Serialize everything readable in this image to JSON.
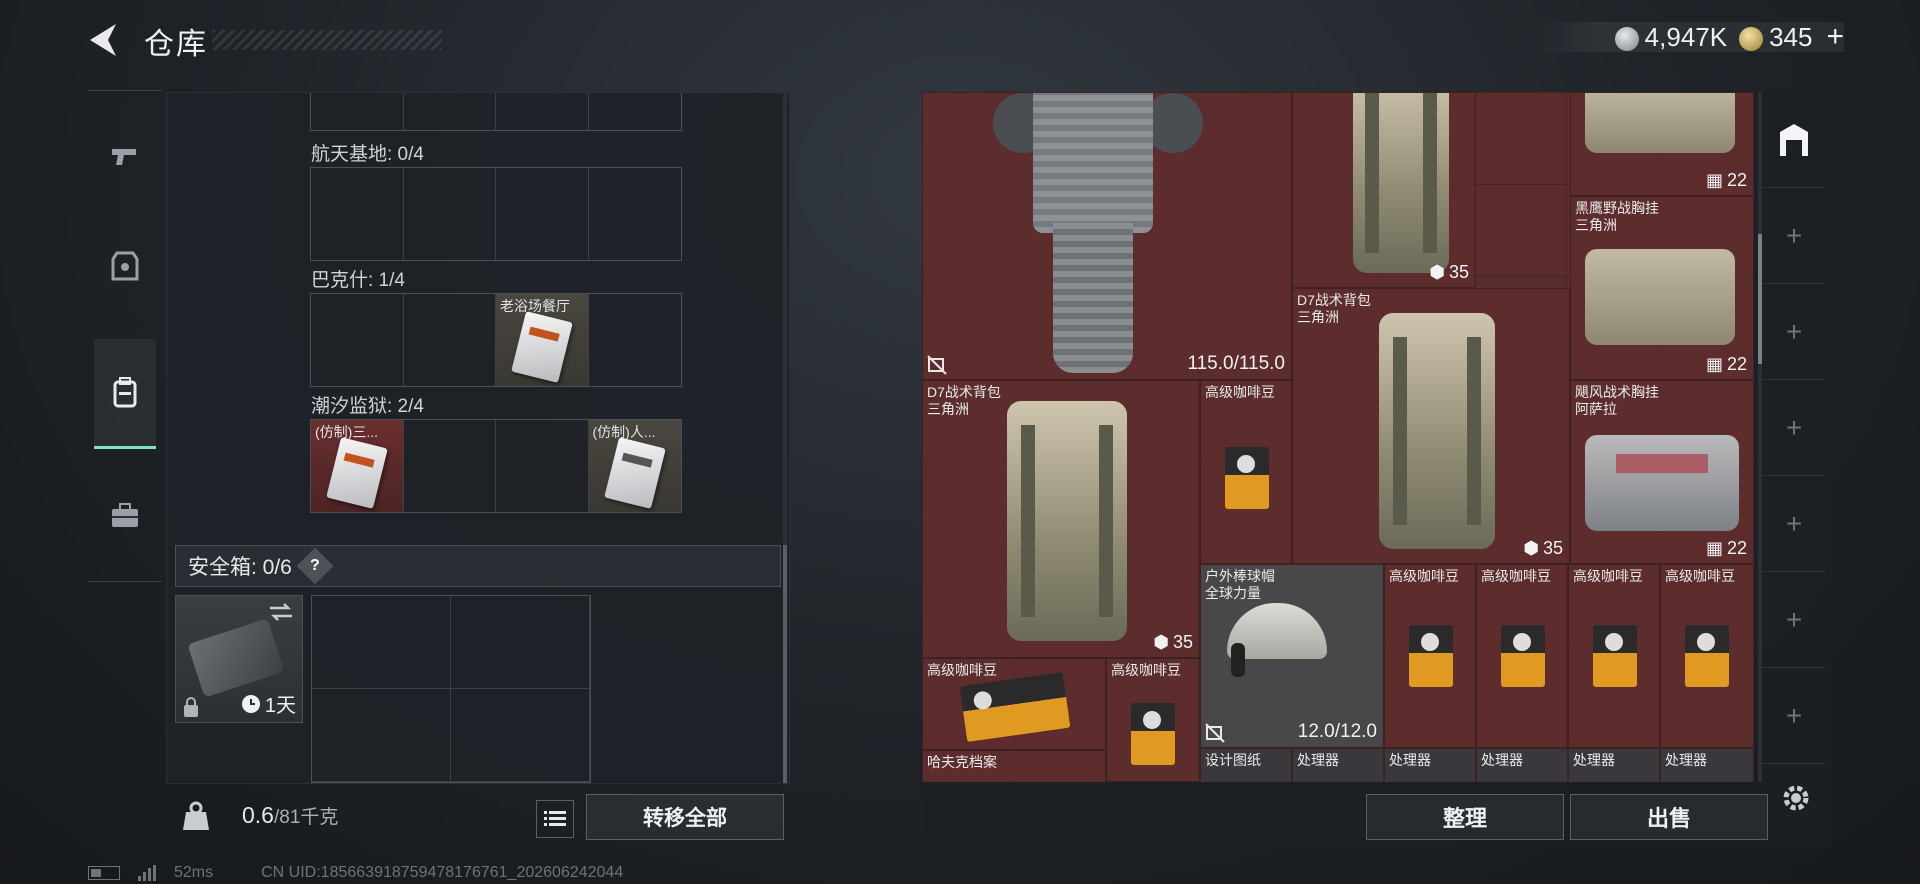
{
  "header": {
    "title": "仓库",
    "currencies": [
      {
        "name": "silver-coin",
        "value": "4,947K"
      },
      {
        "name": "gold-coin",
        "value": "345"
      }
    ],
    "add_symbol": "+"
  },
  "nav": {
    "items": [
      {
        "icon": "pistol-icon"
      },
      {
        "icon": "armor-icon"
      },
      {
        "icon": "backpack-icon"
      },
      {
        "icon": "toolbox-icon"
      }
    ]
  },
  "collection": {
    "maps": [
      {
        "label": "航天基地: 0/4"
      },
      {
        "label": "巴克什: 1/4",
        "item": "老浴场餐厅"
      },
      {
        "label": "潮汐监狱: 2/4",
        "items": [
          "(仿制)三...",
          "(仿制)人..."
        ]
      }
    ]
  },
  "safe": {
    "title": "安全箱:  0/6",
    "help": "?",
    "timer": "1天"
  },
  "footer": {
    "weight_value": "0.6",
    "weight_max": "/81千克",
    "transfer_all": "转移全部"
  },
  "status": {
    "ping": "52ms",
    "uid": "CN UID:18566391875947817676​1_202606242044"
  },
  "stash": {
    "items": [
      {
        "name": "",
        "durability": "115.0/115.0"
      },
      {
        "name": "",
        "count": "35"
      },
      {
        "name": "",
        "count": "22"
      },
      {
        "name": "黑鹰野战胸挂\n三角洲",
        "count": "22"
      },
      {
        "name": "D7战术背包\n三角洲",
        "count": "35"
      },
      {
        "name": "D7战术背包\n三角洲",
        "count": "35"
      },
      {
        "name": "高级咖啡豆"
      },
      {
        "name": "飓风战术胸挂\n阿萨拉",
        "count": "22"
      },
      {
        "name": "户外棒球帽\n全球力量",
        "durability": "12.0/12.0"
      },
      {
        "name": "高级咖啡豆"
      },
      {
        "name": "高级咖啡豆"
      },
      {
        "name": "高级咖啡豆"
      },
      {
        "name": "高级咖啡豆"
      },
      {
        "name": "高级咖啡豆"
      },
      {
        "name": "高级咖啡豆"
      },
      {
        "name": "哈夫克档案"
      },
      {
        "name": "设计图纸"
      },
      {
        "name": "处理器"
      },
      {
        "name": "处理器"
      },
      {
        "name": "处理器"
      },
      {
        "name": "处理器"
      },
      {
        "name": "处理器"
      }
    ],
    "tools": [
      "+",
      "+",
      "+",
      "+",
      "+",
      "+"
    ],
    "sort_label": "整理",
    "sell_label": "出售"
  }
}
